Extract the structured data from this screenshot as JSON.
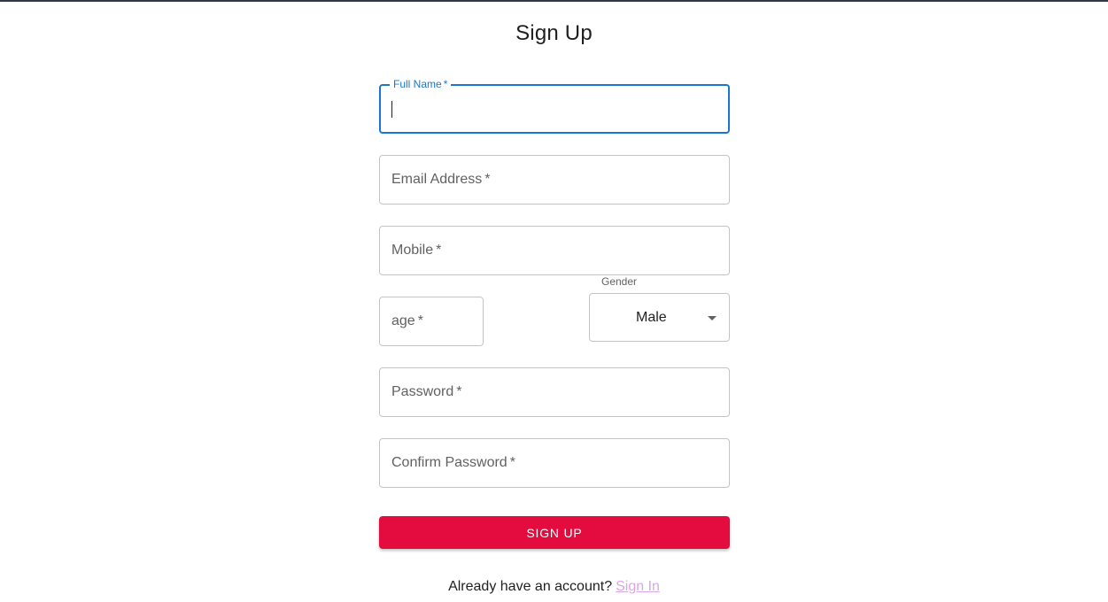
{
  "page": {
    "title": "Sign Up"
  },
  "fields": {
    "full_name": {
      "label": "Full Name",
      "required": "*",
      "value": ""
    },
    "email": {
      "label": "Email Address",
      "required": "*",
      "value": ""
    },
    "mobile": {
      "label": "Mobile",
      "required": "*",
      "value": ""
    },
    "age": {
      "label": "age",
      "required": "*",
      "value": ""
    },
    "gender": {
      "label": "Gender",
      "selected": "Male"
    },
    "password": {
      "label": "Password",
      "required": "*",
      "value": ""
    },
    "confirm_password": {
      "label": "Confirm Password",
      "required": "*",
      "value": ""
    }
  },
  "actions": {
    "signup_label": "SIGN UP"
  },
  "footer": {
    "prompt": "Already have an account?",
    "signin_link": "Sign In"
  },
  "colors": {
    "primary": "#1976d2",
    "button": "#e40b3f",
    "link": "#d8a7e6"
  },
  "icons": {
    "select_arrow": "chevron-down-icon"
  }
}
